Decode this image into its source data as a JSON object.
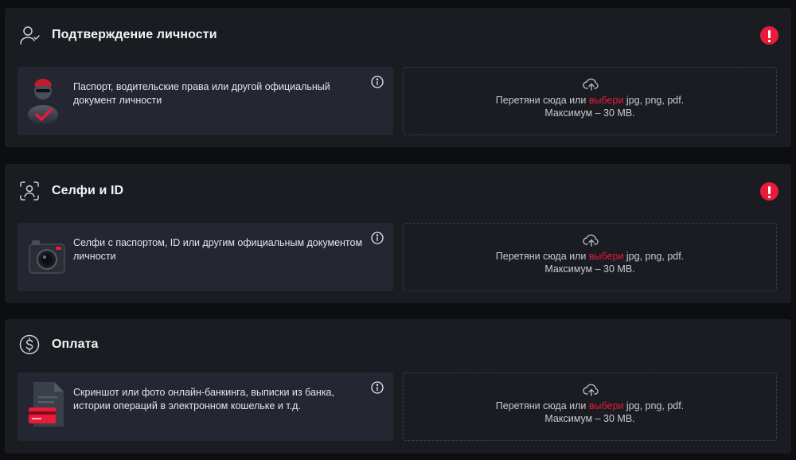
{
  "colors": {
    "accent": "#ea1b3a",
    "panel": "#1a1c22",
    "card": "#242731",
    "background": "#0d0e12"
  },
  "sections": [
    {
      "title": "Подтверждение личности",
      "icon": "user-check-icon",
      "alert_icon": "exclamation-icon",
      "card": {
        "image": "secret-agent-image",
        "text": "Паспорт, водительские права или другой официальный документ личности",
        "info_icon": "info-icon"
      },
      "upload": {
        "icon": "cloud-upload-icon",
        "prefix": "Перетяни сюда или",
        "link": "выбери",
        "formats": "jpg, png, pdf.",
        "limit": "Максимум – 30 MB."
      }
    },
    {
      "title": "Селфи и ID",
      "icon": "face-scan-icon",
      "alert_icon": "exclamation-icon",
      "card": {
        "image": "camera-image",
        "text": "Селфи с паспортом, ID или другим официальным документом личности",
        "info_icon": "info-icon"
      },
      "upload": {
        "icon": "cloud-upload-icon",
        "prefix": "Перетяни сюда или",
        "link": "выбери",
        "formats": "jpg, png, pdf.",
        "limit": "Максимум – 30 MB."
      }
    },
    {
      "title": "Оплата",
      "icon": "dollar-circle-icon",
      "card": {
        "image": "bank-statement-image",
        "text": "Скриншот или фото онлайн-банкинга, выписки из банка, истории операций в электронном кошельке и т.д.",
        "info_icon": "info-icon"
      },
      "upload": {
        "icon": "cloud-upload-icon",
        "prefix": "Перетяни сюда или",
        "link": "выбери",
        "formats": "jpg, png, pdf.",
        "limit": "Максимум – 30 MB."
      }
    }
  ]
}
